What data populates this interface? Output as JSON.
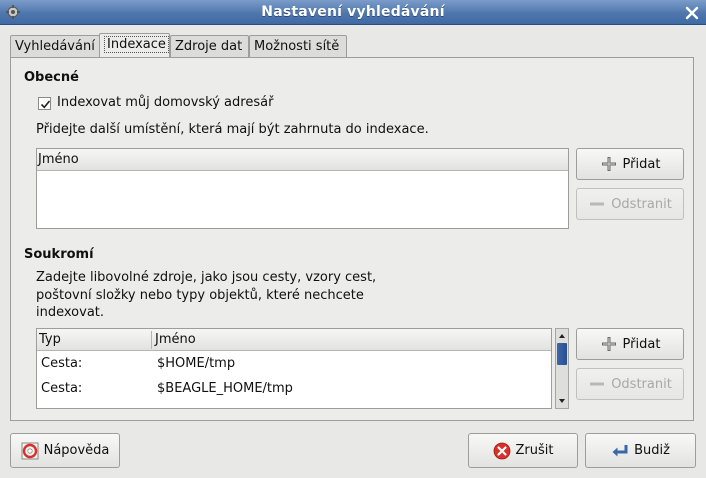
{
  "window": {
    "title": "Nastavení vyhledávání"
  },
  "tabs": [
    {
      "label": "Vyhledávání",
      "active": false
    },
    {
      "label": "Indexace",
      "active": true
    },
    {
      "label": "Zdroje dat",
      "active": false
    },
    {
      "label": "Možnosti sítě",
      "active": false
    }
  ],
  "general": {
    "heading": "Obecné",
    "index_home_label": "Indexovat můj domovský adresář",
    "index_home_checked": true,
    "extra_locations_text": "Přidejte další umístění, která mají být zahrnuta do indexace.",
    "locations_list": {
      "column_name": "Jméno",
      "rows": []
    },
    "add_label": "Přidat",
    "remove_label": "Odstranit",
    "remove_enabled": false
  },
  "privacy": {
    "heading": "Soukromí",
    "description_line1": "Zadejte libovolné zdroje, jako jsou cesty, vzory cest,",
    "description_line2": "poštovní složky nebo typy objektů, které nechcete",
    "description_line3": "indexovat.",
    "exclude_list": {
      "column_type": "Typ",
      "column_name": "Jméno",
      "rows": [
        {
          "type": "Cesta:",
          "name": "$HOME/tmp"
        },
        {
          "type": "Cesta:",
          "name": "$BEAGLE_HOME/tmp"
        }
      ]
    },
    "add_label": "Přidat",
    "remove_label": "Odstranit",
    "remove_enabled": false
  },
  "footer": {
    "help_label": "Nápověda",
    "cancel_label": "Zrušit",
    "ok_label": "Budiž"
  },
  "colors": {
    "titlebar": "#4f77ad",
    "cancel_icon": "#d9302a",
    "scroll_thumb": "#2a4f93"
  }
}
